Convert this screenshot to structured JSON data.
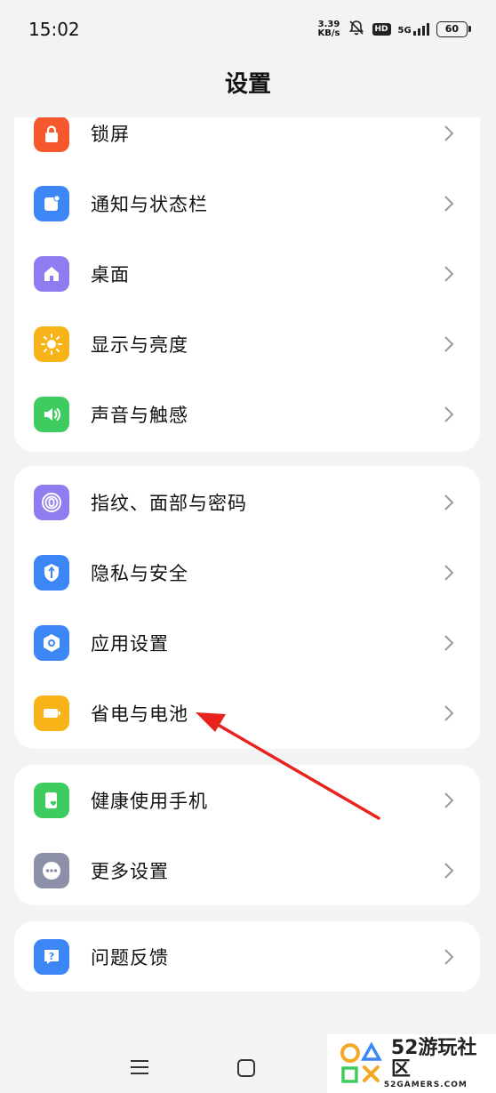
{
  "status_bar": {
    "time": "15:02",
    "speed_value": "3.39",
    "speed_unit": "KB/s",
    "hd": "HD",
    "network": "5G",
    "battery": "60"
  },
  "header": {
    "title": "设置"
  },
  "groups": [
    {
      "items": [
        {
          "label": "锁屏",
          "icon": "lock-icon",
          "color": "#f5582d"
        },
        {
          "label": "通知与状态栏",
          "icon": "notification-icon",
          "color": "#3d86f5"
        },
        {
          "label": "桌面",
          "icon": "home-icon",
          "color": "#8e7cf0"
        },
        {
          "label": "显示与亮度",
          "icon": "sun-icon",
          "color": "#f8b318"
        },
        {
          "label": "声音与触感",
          "icon": "speaker-icon",
          "color": "#3ecb5f"
        }
      ]
    },
    {
      "items": [
        {
          "label": "指纹、面部与密码",
          "icon": "fingerprint-icon",
          "color": "#8e7cf0"
        },
        {
          "label": "隐私与安全",
          "icon": "shield-icon",
          "color": "#3d86f5"
        },
        {
          "label": "应用设置",
          "icon": "hexagon-gear-icon",
          "color": "#3d86f5"
        },
        {
          "label": "省电与电池",
          "icon": "battery-icon",
          "color": "#f8b318"
        }
      ]
    },
    {
      "items": [
        {
          "label": "健康使用手机",
          "icon": "phone-heart-icon",
          "color": "#3ecb5f"
        },
        {
          "label": "更多设置",
          "icon": "more-icon",
          "color": "#8c8fa8"
        }
      ]
    },
    {
      "items": [
        {
          "label": "问题反馈",
          "icon": "feedback-icon",
          "color": "#3d86f5"
        }
      ]
    }
  ],
  "watermark": {
    "brand": "52游玩社区",
    "domain": "52GAMERS.COM"
  }
}
